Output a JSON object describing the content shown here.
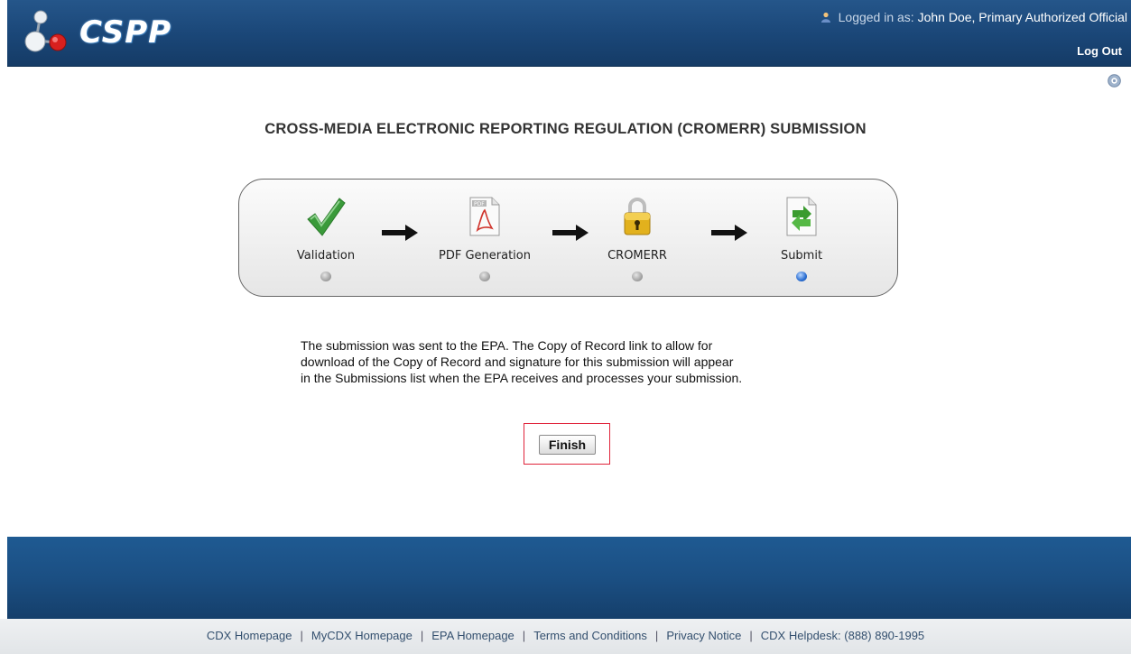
{
  "header": {
    "logo_text": "CSPP",
    "login_prefix": "Logged in as:",
    "user": "John Doe, Primary Authorized Official",
    "logout": "Log Out",
    "icons": [
      "molecule-logo-icon",
      "user-icon",
      "help-icon"
    ]
  },
  "page": {
    "title": "CROSS-MEDIA ELECTRONIC REPORTING REGULATION (CROMERR) SUBMISSION"
  },
  "workflow": {
    "steps": [
      {
        "label": "Validation",
        "icon": "checkmark-icon",
        "active": false
      },
      {
        "label": "PDF Generation",
        "icon": "pdf-document-icon",
        "active": false
      },
      {
        "label": "CROMERR",
        "icon": "padlock-icon",
        "active": false
      },
      {
        "label": "Submit",
        "icon": "submit-document-icon",
        "active": true
      }
    ],
    "active_step": "Submit"
  },
  "message": {
    "line1": "The submission was sent to the EPA. The Copy of Record link to allow for",
    "line2": "download of the Copy of Record and signature for this submission will appear",
    "line3": "in the Submissions list when the EPA receives and processes your submission."
  },
  "actions": {
    "finish": "Finish"
  },
  "footer": {
    "links": [
      "CDX Homepage",
      "MyCDX Homepage",
      "EPA Homepage",
      "Terms and Conditions",
      "Privacy Notice",
      "CDX Helpdesk: (888) 890-1995"
    ],
    "separator": "|"
  },
  "colors": {
    "header": "#1a4677",
    "active_dot": "#2a6dd1",
    "checkmark": "#3a9a3a",
    "finish_highlight": "#e0233a"
  }
}
